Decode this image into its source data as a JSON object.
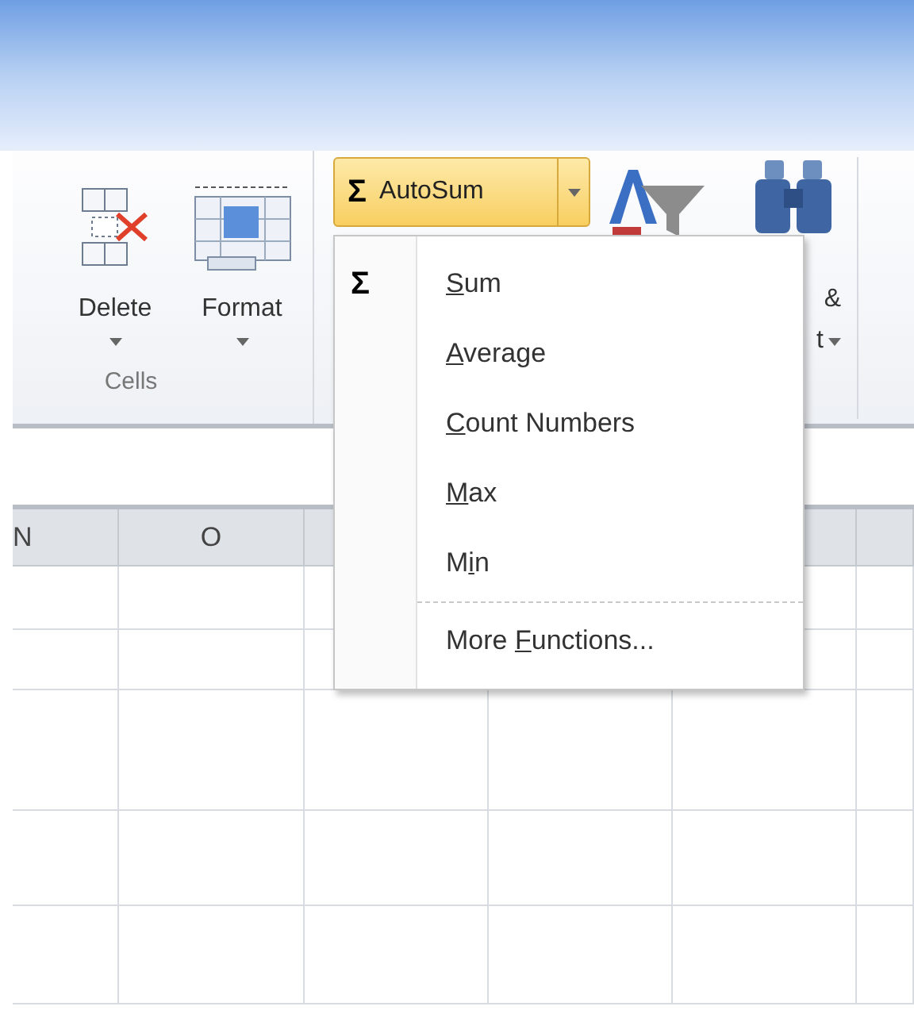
{
  "ribbon": {
    "cells_group": {
      "label": "Cells",
      "buttons": [
        {
          "label": "Delete",
          "kind": "delete"
        },
        {
          "label": "Format",
          "kind": "format"
        }
      ]
    },
    "autosum": {
      "symbol": "Σ",
      "label": "AutoSum",
      "expanded": true
    },
    "find_select": {
      "line_1": "&",
      "line_2": "t"
    }
  },
  "menu": {
    "sections": [
      [
        {
          "icon": "Σ",
          "key": "S",
          "post": "um"
        },
        {
          "key": "A",
          "post": "verage"
        },
        {
          "key": "C",
          "post": "ount Numbers"
        },
        {
          "key": "M",
          "post": "ax"
        },
        {
          "pre": "M",
          "key": "i",
          "post": "n"
        }
      ],
      [
        {
          "pre": "More ",
          "key": "F",
          "post": "unctions..."
        }
      ]
    ]
  },
  "grid": {
    "columns": [
      {
        "label": "N"
      },
      {
        "label": "O"
      }
    ]
  }
}
